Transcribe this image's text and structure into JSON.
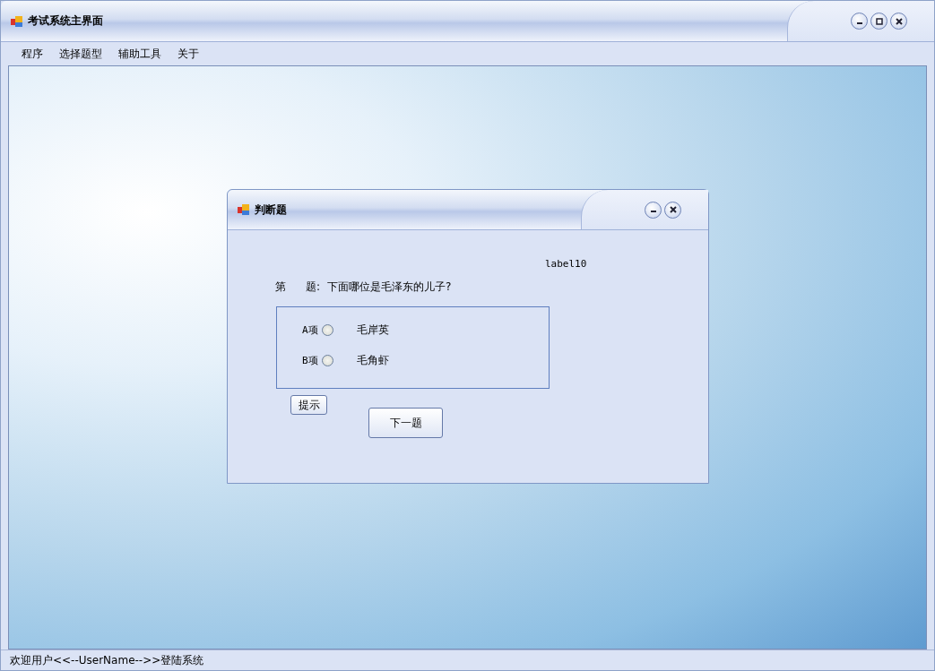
{
  "window": {
    "title": "考试系统主界面"
  },
  "menu": [
    {
      "label": "程序"
    },
    {
      "label": "选择题型"
    },
    {
      "label": "辅助工具"
    },
    {
      "label": "关于"
    }
  ],
  "dialog": {
    "title": "判断题",
    "label": "label10",
    "question_prefix": "第",
    "question_suffix": "题:",
    "question": "下面哪位是毛泽东的儿子?",
    "options": [
      {
        "label": "A项",
        "text": "毛岸英",
        "selected": false
      },
      {
        "label": "B项",
        "text": "毛角虾",
        "selected": false
      }
    ],
    "hint_button": "提示",
    "next_button": "下一题"
  },
  "status_bar": "欢迎用户<<--UserName-->>登陆系统"
}
